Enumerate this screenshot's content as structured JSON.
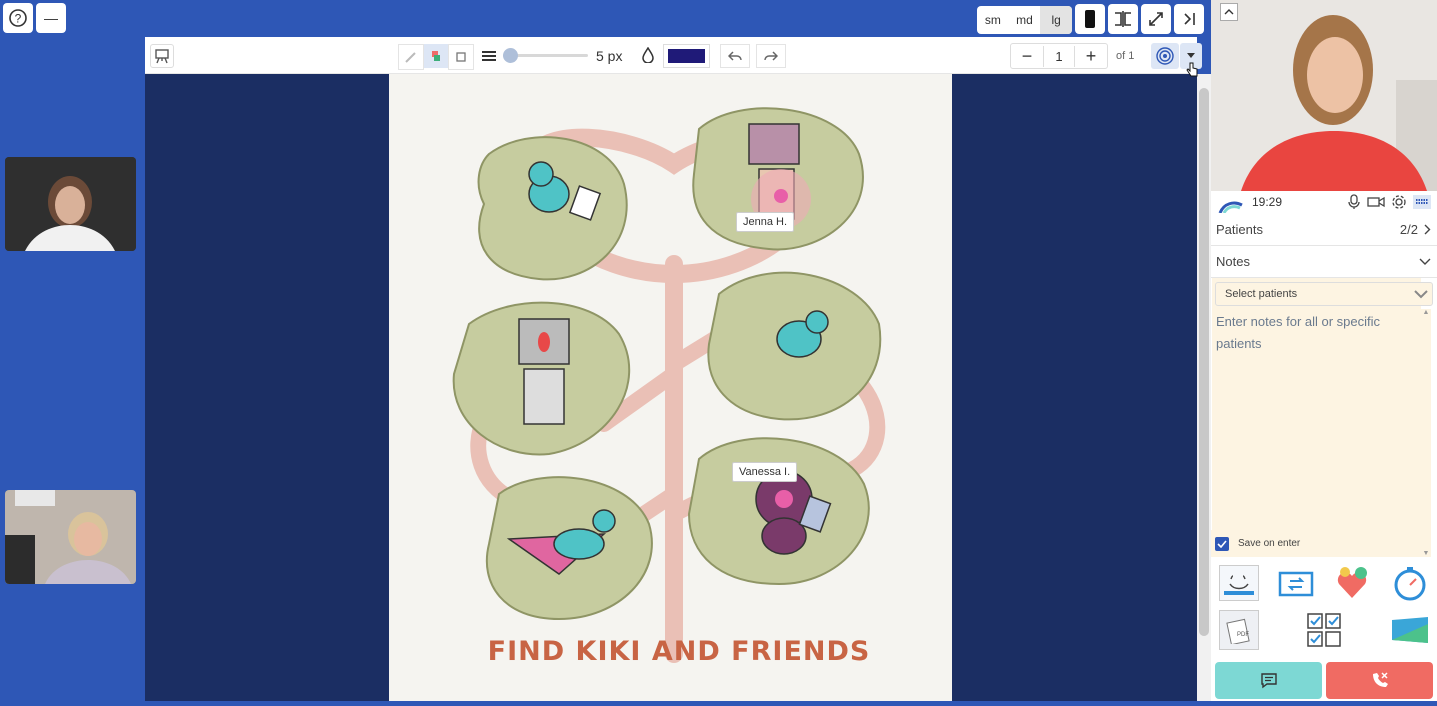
{
  "toolbar": {
    "stroke_size": "5 px",
    "color": "#1f1a78",
    "page_current": "1",
    "page_total": "of 1"
  },
  "size_buttons": [
    "sm",
    "md",
    "lg"
  ],
  "canvas": {
    "title": "FIND KIKI AND FRIENDS",
    "cursor_labels": [
      "Jenna H.",
      "Vanessa I."
    ]
  },
  "panel": {
    "time": "19:29",
    "patients_label": "Patients",
    "patients_count": "2/2",
    "notes_label": "Notes",
    "select_placeholder": "Select patients",
    "notes_placeholder": "Enter notes for all or specific patients",
    "save_on_enter": "Save on enter"
  },
  "colors": {
    "brand_blue": "#2e57b6",
    "canvas_navy": "#1b2e63",
    "chat_button": "#7dd8d4",
    "end_call_button": "#f06b63"
  }
}
